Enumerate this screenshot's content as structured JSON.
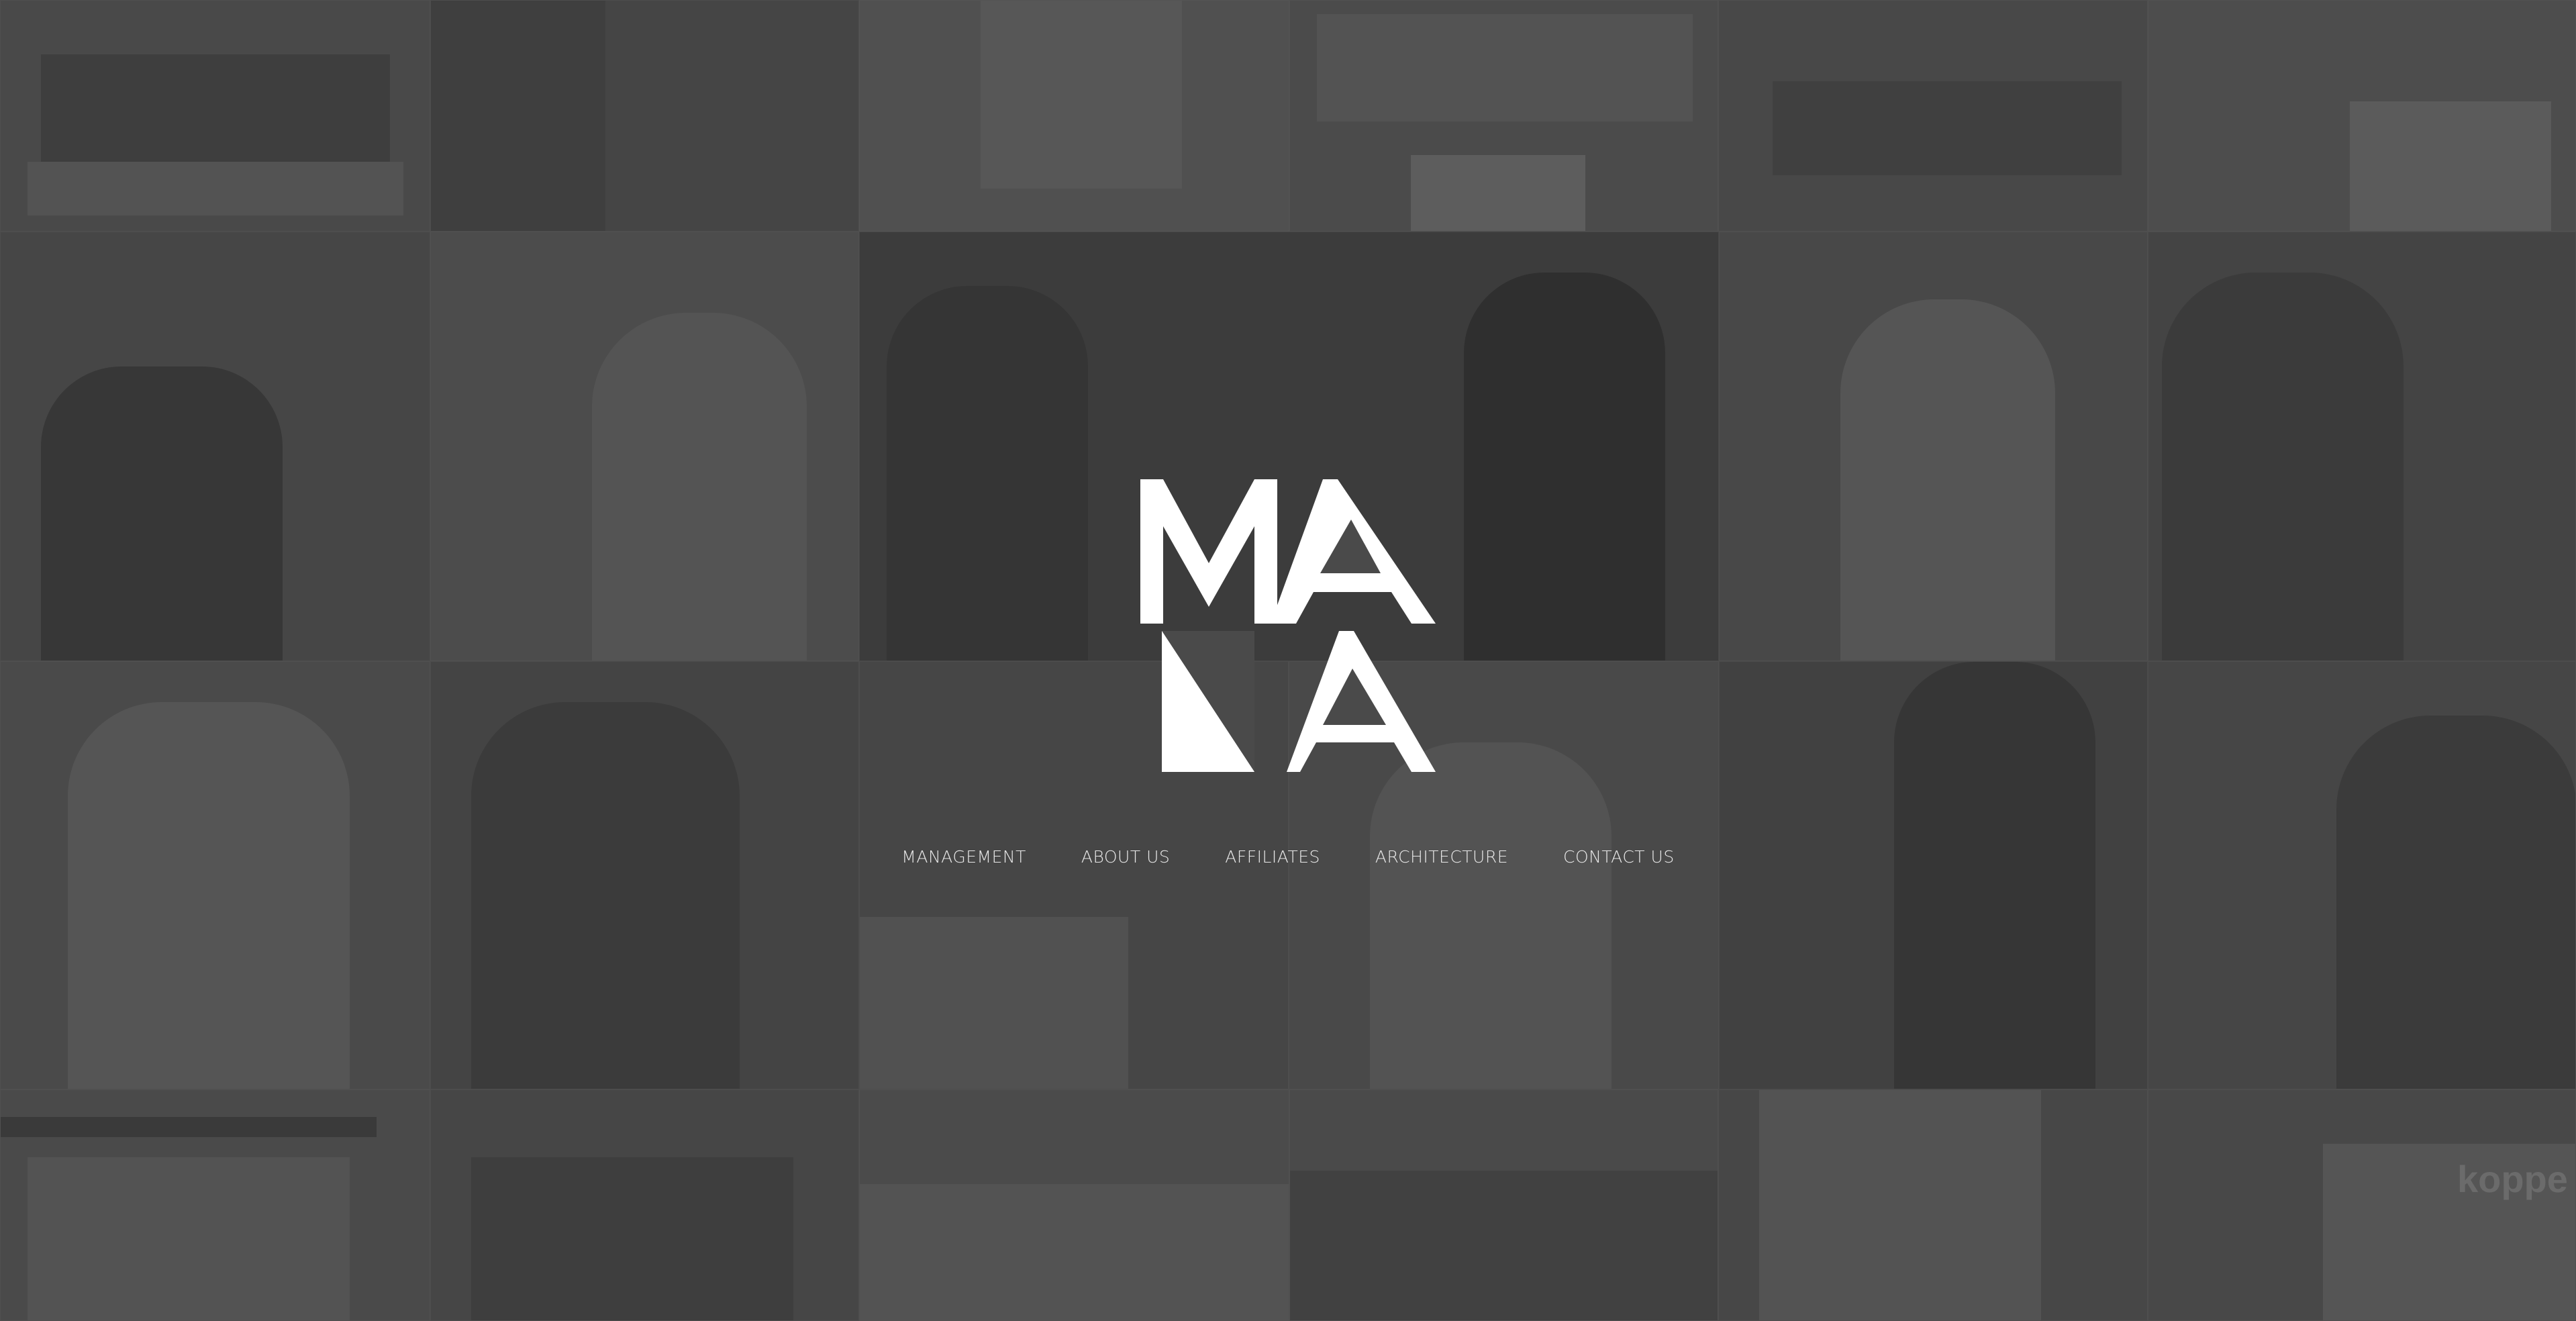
{
  "brand": {
    "name": "MANA",
    "logo_icon": "mana-logo-icon",
    "logo_color": "#ffffff"
  },
  "nav": {
    "items": [
      {
        "label": "MANAGEMENT"
      },
      {
        "label": "ABOUT US"
      },
      {
        "label": "AFFILIATES"
      },
      {
        "label": "ARCHITECTURE"
      },
      {
        "label": "CONTACT US"
      }
    ]
  },
  "background": {
    "overlay_color": "#3a3a3a",
    "sign_text": "koppe"
  }
}
